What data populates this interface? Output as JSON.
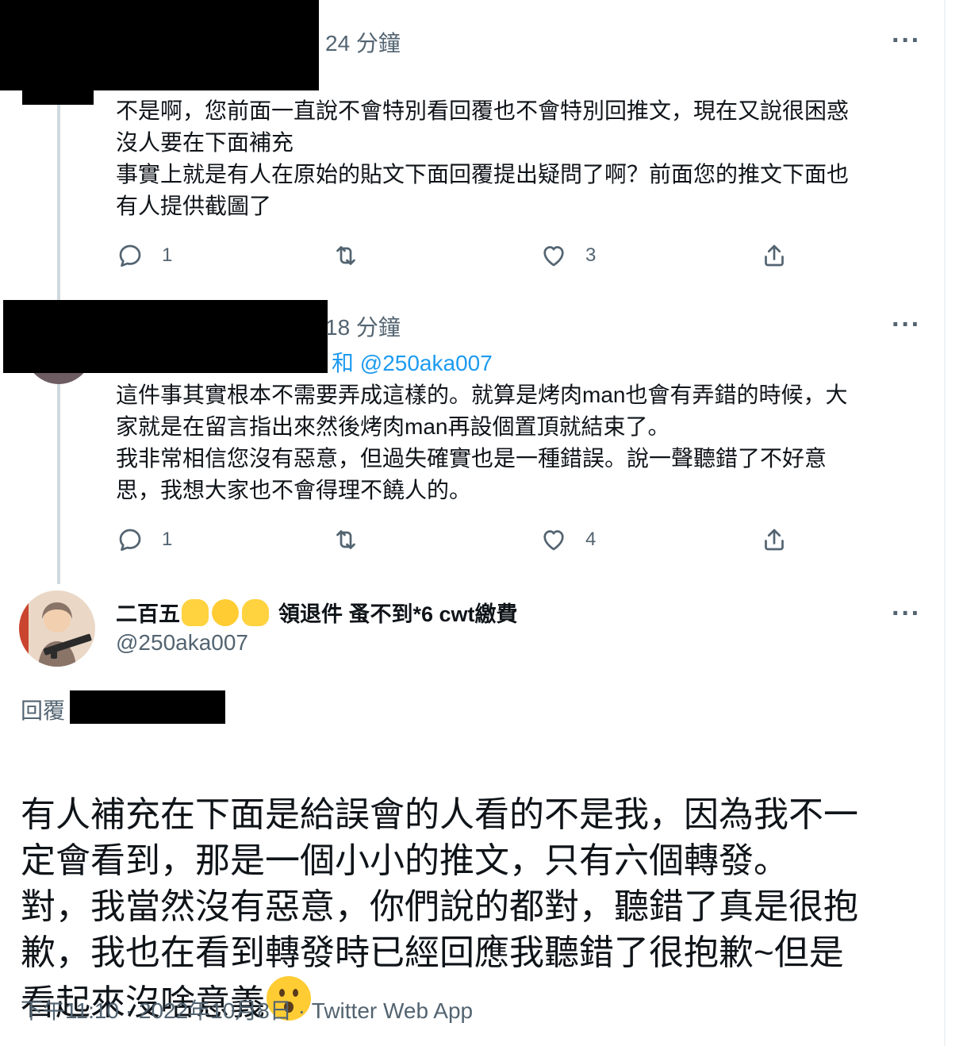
{
  "reply1": {
    "time": "24 分鐘",
    "text": "不是啊，您前面一直說不會特別看回覆也不會特別回推文，現在又說很困惑\n沒人要在下面補充\n事實上就是有人在原始的貼文下面回覆提出疑問了啊？前面您的推文下面也\n有人提供截圖了",
    "actions": {
      "reply_count": "1",
      "retweet_count": "",
      "like_count": "3"
    }
  },
  "reply2": {
    "time": "18 分鐘",
    "replying_to": "和 @250aka007",
    "text": "這件事其實根本不需要弄成這樣的。就算是烤肉man也會有弄錯的時候，大\n家就是在留言指出來然後烤肉man再設個置頂就結束了。\n我非常相信您沒有惡意，但過失確實也是一種錯誤。說一聲聽錯了不好意\n思，我想大家也不會得理不饒人的。",
    "actions": {
      "reply_count": "1",
      "retweet_count": "",
      "like_count": "4"
    }
  },
  "main_tweet": {
    "display_name_prefix": "二百五",
    "display_name_suffix": "領退件 蚤不到*6 cwt繳費",
    "handle": "@250aka007",
    "reply_label": "回覆",
    "text": "有人補充在下面是給誤會的人看的不是我，因為我不一\n定會看到，那是一個小小的推文，只有六個轉發。\n對，我當然沒有惡意，你們說的都對，聽錯了真是很抱\n歉，我也在看到轉發時已經回應我聽錯了很抱歉~但是\n看起來沒啥意義",
    "timestamp": "下午11:10 · 2022年10月8日 · Twitter Web App"
  },
  "more_label": "···",
  "colors": {
    "accent": "#1d9bf0",
    "secondary": "#536471",
    "text": "#0f1419",
    "thread": "#cfd9de"
  }
}
